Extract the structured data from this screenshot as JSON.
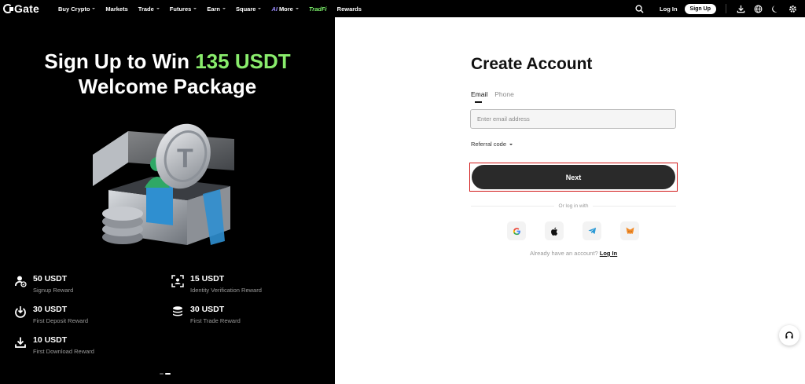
{
  "brand": {
    "name": "Gate"
  },
  "nav": {
    "items": [
      {
        "label": "Buy Crypto",
        "dropdown": true
      },
      {
        "label": "Markets",
        "dropdown": false
      },
      {
        "label": "Trade",
        "dropdown": true
      },
      {
        "label": "Futures",
        "dropdown": true
      },
      {
        "label": "Earn",
        "dropdown": true
      },
      {
        "label": "Square",
        "dropdown": true
      },
      {
        "label": "More",
        "dropdown": true
      },
      {
        "label": "TradFi",
        "dropdown": false
      },
      {
        "label": "Rewards",
        "dropdown": false
      }
    ],
    "ai_tag": "AI",
    "login_label": "Log In",
    "signup_label": "Sign Up",
    "right_icons": [
      "search-icon",
      "download-icon",
      "globe-icon",
      "moon-icon",
      "gear-icon"
    ]
  },
  "promo": {
    "title_line1_prefix": "Sign Up to Win ",
    "title_line1_highlight": "135 USDT",
    "title_line2": "Welcome Package",
    "rewards": [
      {
        "value": "50 USDT",
        "desc": "Signup Reward",
        "icon": "user-check-icon"
      },
      {
        "value": "15 USDT",
        "desc": "Identity Verification Reward",
        "icon": "face-scan-icon"
      },
      {
        "value": "30 USDT",
        "desc": "First Deposit Reward",
        "icon": "power-deposit-icon"
      },
      {
        "value": "30 USDT",
        "desc": "First Trade Reward",
        "icon": "coin-stack-icon"
      },
      {
        "value": "10 USDT",
        "desc": "First Download Reward",
        "icon": "download-icon"
      }
    ],
    "carousel": {
      "count": 2,
      "active": 1
    }
  },
  "form": {
    "title": "Create Account",
    "tabs": [
      {
        "label": "Email",
        "active": true
      },
      {
        "label": "Phone",
        "active": false
      }
    ],
    "email_placeholder": "Enter email address",
    "email_value": "",
    "referral_label": "Referral code",
    "next_label": "Next",
    "divider_text": "Or log in with",
    "social_logins": [
      "google-icon",
      "apple-icon",
      "telegram-icon",
      "metamask-icon"
    ],
    "have_account_text": "Already have an account?",
    "login_link": "Log In"
  },
  "colors": {
    "accent_green": "#89ec6c",
    "tradfi_green": "#7cf36b",
    "button_dark": "#2a2a2a",
    "highlight_red": "#d11a1a"
  }
}
